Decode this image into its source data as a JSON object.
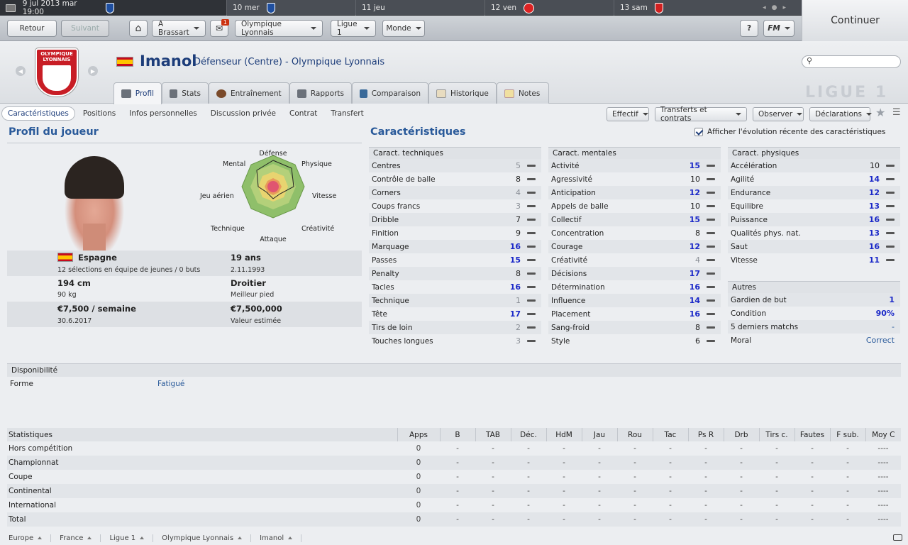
{
  "datebar": {
    "days": [
      {
        "label": "9 jul 2013 mar 19:00",
        "badge": "blue"
      },
      {
        "label": "10 mer",
        "badge": "blue"
      },
      {
        "label": "11 jeu",
        "badge": ""
      },
      {
        "label": "12 ven",
        "badge": "red"
      },
      {
        "label": "13 sam",
        "badge": "redshield"
      }
    ]
  },
  "continue_label": "Continuer",
  "toolbar": {
    "back": "Retour",
    "forward": "Suivant",
    "manager": "A Brassart",
    "inbox_count": "1",
    "club": "Olympique Lyonnais",
    "league": "Ligue 1",
    "world": "Monde",
    "help": "?",
    "fm": "FM"
  },
  "header": {
    "club_logo_text": "OLYMPIQUE LYONNAIS",
    "player_name": "Imanol",
    "player_role": "Défenseur (Centre) - Olympique Lyonnais",
    "watermark": "LIGUE 1"
  },
  "tabs": [
    "Profil",
    "Stats",
    "Entraînement",
    "Rapports",
    "Comparaison",
    "Historique",
    "Notes"
  ],
  "subnav": [
    "Caractéristiques",
    "Positions",
    "Infos personnelles",
    "Discussion privée",
    "Contrat",
    "Transfert"
  ],
  "actions": [
    "Effectif",
    "Transferts et contrats",
    "Observer",
    "Déclarations"
  ],
  "profile": {
    "title": "Profil du joueur",
    "radar_labels": [
      "Défense",
      "Physique",
      "Vitesse",
      "Créativité",
      "Attaque",
      "Technique",
      "Jeu aérien",
      "Mental"
    ],
    "nationality": "Espagne",
    "caps": "12 sélections en équipe de jeunes / 0 buts",
    "age": "19 ans",
    "dob": "2.11.1993",
    "height": "194 cm",
    "weight": "90 kg",
    "foot": "Droitier",
    "foot_label": "Meilleur pied",
    "wage": "€7,500 / semaine",
    "contract_end": "30.6.2017",
    "value": "€7,500,000",
    "value_label": "Valeur estimée"
  },
  "attributes": {
    "title": "Caractéristiques",
    "show_evolution": "Afficher l'évolution récente des caractéristiques",
    "technical": {
      "header": "Caract. techniques",
      "rows": [
        [
          "Centres",
          5
        ],
        [
          "Contrôle de balle",
          8
        ],
        [
          "Corners",
          4
        ],
        [
          "Coups francs",
          3
        ],
        [
          "Dribble",
          7
        ],
        [
          "Finition",
          9
        ],
        [
          "Marquage",
          16
        ],
        [
          "Passes",
          15
        ],
        [
          "Penalty",
          8
        ],
        [
          "Tacles",
          16
        ],
        [
          "Technique",
          1
        ],
        [
          "Tête",
          17
        ],
        [
          "Tirs de loin",
          2
        ],
        [
          "Touches longues",
          3
        ]
      ]
    },
    "mental": {
      "header": "Caract. mentales",
      "rows": [
        [
          "Activité",
          15
        ],
        [
          "Agressivité",
          10
        ],
        [
          "Anticipation",
          12
        ],
        [
          "Appels de balle",
          10
        ],
        [
          "Collectif",
          15
        ],
        [
          "Concentration",
          8
        ],
        [
          "Courage",
          12
        ],
        [
          "Créativité",
          4
        ],
        [
          "Décisions",
          17
        ],
        [
          "Détermination",
          16
        ],
        [
          "Influence",
          14
        ],
        [
          "Placement",
          16
        ],
        [
          "Sang-froid",
          8
        ],
        [
          "Style",
          6
        ]
      ]
    },
    "physical": {
      "header": "Caract. physiques",
      "rows": [
        [
          "Accélération",
          10
        ],
        [
          "Agilité",
          14
        ],
        [
          "Endurance",
          12
        ],
        [
          "Equilibre",
          13
        ],
        [
          "Puissance",
          16
        ],
        [
          "Qualités phys. nat.",
          13
        ],
        [
          "Saut",
          16
        ],
        [
          "Vitesse",
          11
        ]
      ]
    },
    "other": {
      "header": "Autres",
      "rows": [
        [
          "Gardien de but",
          "1"
        ],
        [
          "Condition",
          "90%"
        ],
        [
          "5 derniers matchs",
          "-"
        ],
        [
          "Moral",
          "Correct"
        ]
      ]
    }
  },
  "availability": {
    "header": "Disponibilité",
    "label": "Forme",
    "value": "Fatigué"
  },
  "stats": {
    "columns": [
      "Statistiques",
      "Apps",
      "B",
      "TAB",
      "Déc.",
      "HdM",
      "Jau",
      "Rou",
      "Tac",
      "Ps R",
      "Drb",
      "Tirs c.",
      "Fautes",
      "F sub.",
      "Moy C"
    ],
    "rows": [
      [
        "Hors compétition",
        "0",
        "-",
        "-",
        "-",
        "-",
        "-",
        "-",
        "-",
        "-",
        "-",
        "-",
        "-",
        "-",
        "----"
      ],
      [
        "Championnat",
        "0",
        "-",
        "-",
        "-",
        "-",
        "-",
        "-",
        "-",
        "-",
        "-",
        "-",
        "-",
        "-",
        "----"
      ],
      [
        "Coupe",
        "0",
        "-",
        "-",
        "-",
        "-",
        "-",
        "-",
        "-",
        "-",
        "-",
        "-",
        "-",
        "-",
        "----"
      ],
      [
        "Continental",
        "0",
        "-",
        "-",
        "-",
        "-",
        "-",
        "-",
        "-",
        "-",
        "-",
        "-",
        "-",
        "-",
        "----"
      ],
      [
        "International",
        "0",
        "-",
        "-",
        "-",
        "-",
        "-",
        "-",
        "-",
        "-",
        "-",
        "-",
        "-",
        "-",
        "----"
      ],
      [
        "Total",
        "0",
        "-",
        "-",
        "-",
        "-",
        "-",
        "-",
        "-",
        "-",
        "-",
        "-",
        "-",
        "-",
        "----"
      ]
    ]
  },
  "breadcrumbs": [
    "Europe",
    "France",
    "Ligue 1",
    "Olympique Lyonnais",
    "Imanol"
  ]
}
